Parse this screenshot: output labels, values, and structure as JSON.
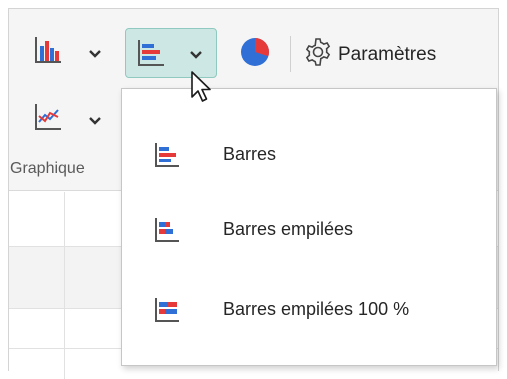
{
  "ribbon": {
    "buttons": [
      {
        "icon": "column-chart-icon"
      },
      {
        "icon": "bar-chart-icon",
        "state": "pressed"
      },
      {
        "icon": "pie-chart-icon"
      },
      {
        "icon": "line-chart-icon"
      }
    ],
    "settings_label": "Paramètres",
    "group_label": "Graphique"
  },
  "menu": {
    "items": [
      {
        "label": "Barres",
        "icon": "clustered-bar-icon"
      },
      {
        "label": "Barres empilées",
        "icon": "stacked-bar-icon"
      },
      {
        "label": "Barres empilées 100 %",
        "icon": "stacked-bar-100-icon"
      }
    ]
  },
  "colors": {
    "accent_blue": "#2f6fd6",
    "accent_red": "#e63a3a",
    "pressed_bg": "#cde8e4",
    "pressed_border": "#8fc9c0"
  }
}
